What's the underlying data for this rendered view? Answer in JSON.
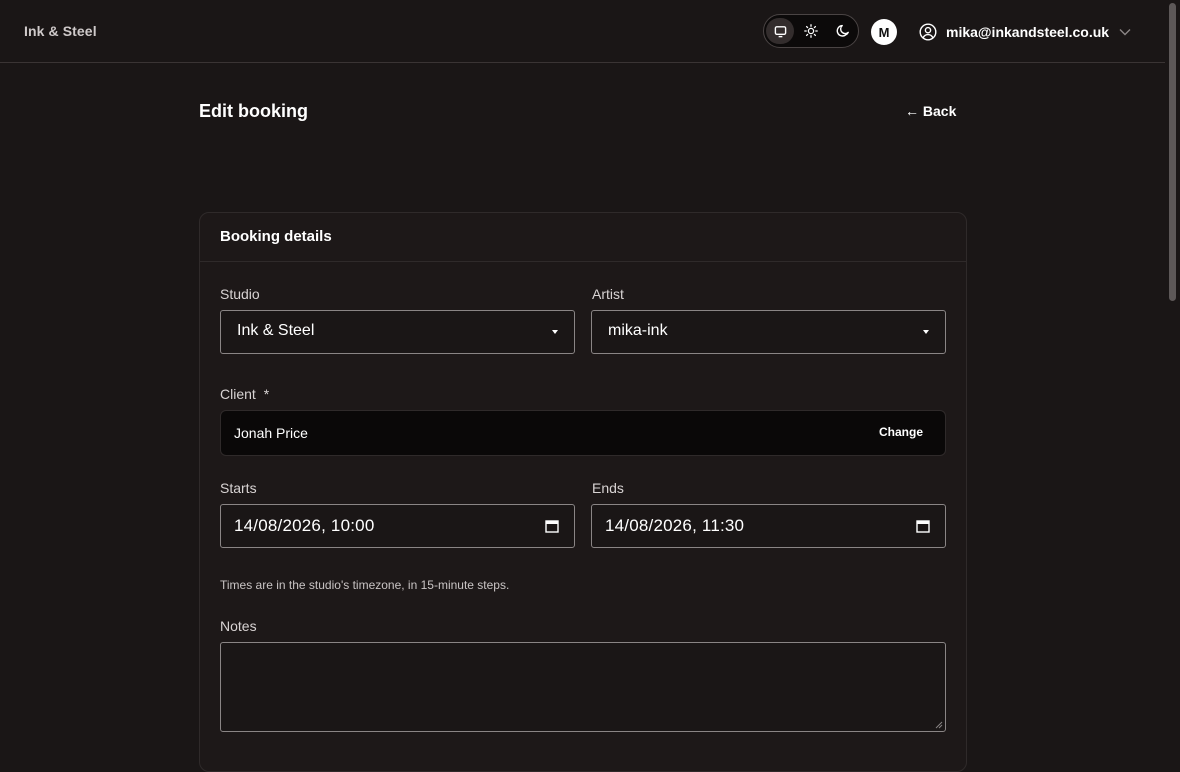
{
  "app": {
    "brand": "Ink & Steel"
  },
  "header": {
    "theme_options": [
      "system",
      "light",
      "dark"
    ],
    "theme_selected": "system",
    "avatar_initial": "M",
    "user_email": "mika@inkandsteel.co.uk"
  },
  "page": {
    "title": "Edit booking",
    "back_label": "← Back"
  },
  "card": {
    "title": "Booking details",
    "studio": {
      "label": "Studio",
      "value": "Ink & Steel"
    },
    "artist": {
      "label": "Artist",
      "value": "mika-ink"
    },
    "client": {
      "label": "Client",
      "required_mark": "*",
      "value": "Jonah Price",
      "change_label": "Change"
    },
    "starts": {
      "label": "Starts",
      "value": "14/08/2026, 10:00"
    },
    "ends": {
      "label": "Ends",
      "value": "14/08/2026, 11:30"
    },
    "hint": "Times are in the studio's timezone, in 15-minute steps.",
    "notes": {
      "label": "Notes",
      "value": ""
    }
  },
  "colors": {
    "background": "#1a1616",
    "card": "#1d1818",
    "border": "#8a8585",
    "text": "#ffffff"
  },
  "icons": {
    "system": "monitor-icon",
    "light": "sun-icon",
    "dark": "moon-icon",
    "user": "user-circle-icon",
    "menu": "chevron-down-icon",
    "back": "arrow-left-icon",
    "calendar": "calendar-icon"
  }
}
